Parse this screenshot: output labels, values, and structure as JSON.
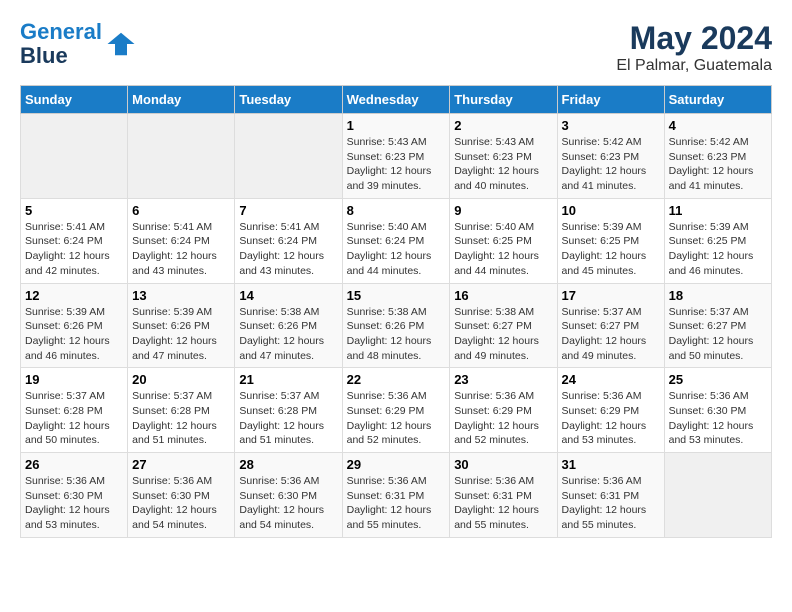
{
  "header": {
    "logo_line1": "General",
    "logo_line2": "Blue",
    "month_year": "May 2024",
    "location": "El Palmar, Guatemala"
  },
  "days_of_week": [
    "Sunday",
    "Monday",
    "Tuesday",
    "Wednesday",
    "Thursday",
    "Friday",
    "Saturday"
  ],
  "weeks": [
    [
      {
        "num": "",
        "empty": true
      },
      {
        "num": "",
        "empty": true
      },
      {
        "num": "",
        "empty": true
      },
      {
        "num": "1",
        "sunrise": "5:43 AM",
        "sunset": "6:23 PM",
        "daylight": "12 hours and 39 minutes."
      },
      {
        "num": "2",
        "sunrise": "5:43 AM",
        "sunset": "6:23 PM",
        "daylight": "12 hours and 40 minutes."
      },
      {
        "num": "3",
        "sunrise": "5:42 AM",
        "sunset": "6:23 PM",
        "daylight": "12 hours and 41 minutes."
      },
      {
        "num": "4",
        "sunrise": "5:42 AM",
        "sunset": "6:23 PM",
        "daylight": "12 hours and 41 minutes."
      }
    ],
    [
      {
        "num": "5",
        "sunrise": "5:41 AM",
        "sunset": "6:24 PM",
        "daylight": "12 hours and 42 minutes."
      },
      {
        "num": "6",
        "sunrise": "5:41 AM",
        "sunset": "6:24 PM",
        "daylight": "12 hours and 43 minutes."
      },
      {
        "num": "7",
        "sunrise": "5:41 AM",
        "sunset": "6:24 PM",
        "daylight": "12 hours and 43 minutes."
      },
      {
        "num": "8",
        "sunrise": "5:40 AM",
        "sunset": "6:24 PM",
        "daylight": "12 hours and 44 minutes."
      },
      {
        "num": "9",
        "sunrise": "5:40 AM",
        "sunset": "6:25 PM",
        "daylight": "12 hours and 44 minutes."
      },
      {
        "num": "10",
        "sunrise": "5:39 AM",
        "sunset": "6:25 PM",
        "daylight": "12 hours and 45 minutes."
      },
      {
        "num": "11",
        "sunrise": "5:39 AM",
        "sunset": "6:25 PM",
        "daylight": "12 hours and 46 minutes."
      }
    ],
    [
      {
        "num": "12",
        "sunrise": "5:39 AM",
        "sunset": "6:26 PM",
        "daylight": "12 hours and 46 minutes."
      },
      {
        "num": "13",
        "sunrise": "5:39 AM",
        "sunset": "6:26 PM",
        "daylight": "12 hours and 47 minutes."
      },
      {
        "num": "14",
        "sunrise": "5:38 AM",
        "sunset": "6:26 PM",
        "daylight": "12 hours and 47 minutes."
      },
      {
        "num": "15",
        "sunrise": "5:38 AM",
        "sunset": "6:26 PM",
        "daylight": "12 hours and 48 minutes."
      },
      {
        "num": "16",
        "sunrise": "5:38 AM",
        "sunset": "6:27 PM",
        "daylight": "12 hours and 49 minutes."
      },
      {
        "num": "17",
        "sunrise": "5:37 AM",
        "sunset": "6:27 PM",
        "daylight": "12 hours and 49 minutes."
      },
      {
        "num": "18",
        "sunrise": "5:37 AM",
        "sunset": "6:27 PM",
        "daylight": "12 hours and 50 minutes."
      }
    ],
    [
      {
        "num": "19",
        "sunrise": "5:37 AM",
        "sunset": "6:28 PM",
        "daylight": "12 hours and 50 minutes."
      },
      {
        "num": "20",
        "sunrise": "5:37 AM",
        "sunset": "6:28 PM",
        "daylight": "12 hours and 51 minutes."
      },
      {
        "num": "21",
        "sunrise": "5:37 AM",
        "sunset": "6:28 PM",
        "daylight": "12 hours and 51 minutes."
      },
      {
        "num": "22",
        "sunrise": "5:36 AM",
        "sunset": "6:29 PM",
        "daylight": "12 hours and 52 minutes."
      },
      {
        "num": "23",
        "sunrise": "5:36 AM",
        "sunset": "6:29 PM",
        "daylight": "12 hours and 52 minutes."
      },
      {
        "num": "24",
        "sunrise": "5:36 AM",
        "sunset": "6:29 PM",
        "daylight": "12 hours and 53 minutes."
      },
      {
        "num": "25",
        "sunrise": "5:36 AM",
        "sunset": "6:30 PM",
        "daylight": "12 hours and 53 minutes."
      }
    ],
    [
      {
        "num": "26",
        "sunrise": "5:36 AM",
        "sunset": "6:30 PM",
        "daylight": "12 hours and 53 minutes."
      },
      {
        "num": "27",
        "sunrise": "5:36 AM",
        "sunset": "6:30 PM",
        "daylight": "12 hours and 54 minutes."
      },
      {
        "num": "28",
        "sunrise": "5:36 AM",
        "sunset": "6:30 PM",
        "daylight": "12 hours and 54 minutes."
      },
      {
        "num": "29",
        "sunrise": "5:36 AM",
        "sunset": "6:31 PM",
        "daylight": "12 hours and 55 minutes."
      },
      {
        "num": "30",
        "sunrise": "5:36 AM",
        "sunset": "6:31 PM",
        "daylight": "12 hours and 55 minutes."
      },
      {
        "num": "31",
        "sunrise": "5:36 AM",
        "sunset": "6:31 PM",
        "daylight": "12 hours and 55 minutes."
      },
      {
        "num": "",
        "empty": true
      }
    ]
  ],
  "labels": {
    "sunrise": "Sunrise:",
    "sunset": "Sunset:",
    "daylight": "Daylight:"
  }
}
